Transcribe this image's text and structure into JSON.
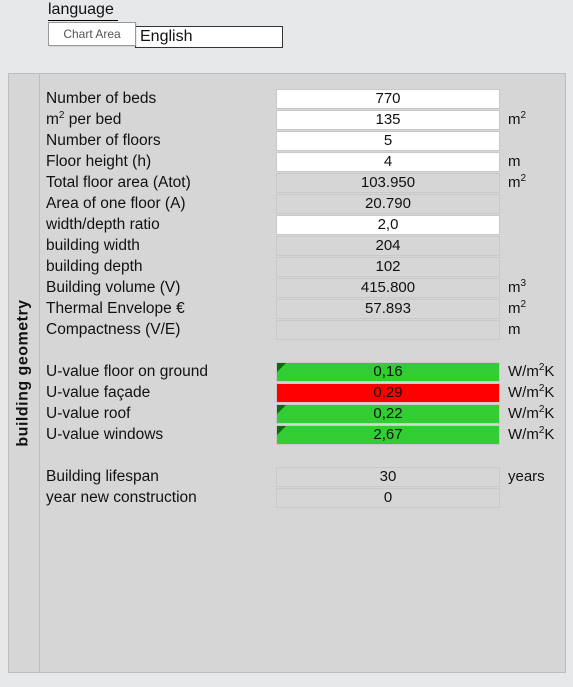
{
  "header": {
    "language_label": "language",
    "chart_area_label": "Chart Area",
    "language_value": "English"
  },
  "section_title": "building  geometry",
  "rows": [
    {
      "label": "Number of beds",
      "value": "770",
      "unit": "",
      "style": "white"
    },
    {
      "label": "m² per bed",
      "value": "135",
      "unit": "m²",
      "style": "white"
    },
    {
      "label": "Number of floors",
      "value": "5",
      "unit": "",
      "style": "white"
    },
    {
      "label": "Floor height (h)",
      "value": "4",
      "unit": "m",
      "style": "white"
    },
    {
      "label": "Total floor area (Atot)",
      "value": "103.950",
      "unit": "m²",
      "style": "grey"
    },
    {
      "label": "Area of one floor (A)",
      "value": "20.790",
      "unit": "",
      "style": "grey"
    },
    {
      "label": "width/depth ratio",
      "value": "2,0",
      "unit": "",
      "style": "white"
    },
    {
      "label": "building width",
      "value": "204",
      "unit": "",
      "style": "grey"
    },
    {
      "label": "building depth",
      "value": "102",
      "unit": "",
      "style": "grey"
    },
    {
      "label": "Building volume (V)",
      "value": "415.800",
      "unit": "m³",
      "style": "grey"
    },
    {
      "label": "Thermal Envelope €",
      "value": "57.893",
      "unit": "m²",
      "style": "grey"
    },
    {
      "label": "Compactness (V/E)",
      "value": "",
      "unit": "m",
      "style": "grey"
    },
    {
      "spacer": true
    },
    {
      "label": "U-value floor on ground",
      "value": "0,16",
      "unit": "W/m²K",
      "style": "green"
    },
    {
      "label": "U-value façade",
      "value": "0,29",
      "unit": "W/m²K",
      "style": "red"
    },
    {
      "label": "U-value roof",
      "value": "0,22",
      "unit": "W/m²K",
      "style": "green"
    },
    {
      "label": "U-value windows",
      "value": "2,67",
      "unit": "W/m²K",
      "style": "green"
    },
    {
      "spacer": true
    },
    {
      "label": "Building lifespan",
      "value": "30",
      "unit": "years",
      "style": "grey"
    },
    {
      "label": "year new construction",
      "value": "0",
      "unit": "",
      "style": "grey"
    }
  ]
}
